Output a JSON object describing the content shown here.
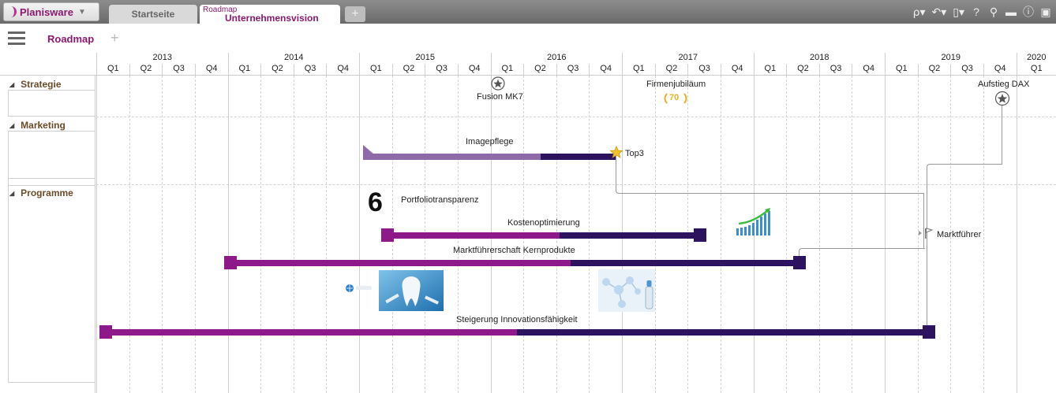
{
  "app": {
    "logo": "Planisware",
    "tabs": [
      {
        "label": "Startseite"
      },
      {
        "small": "Roadmap",
        "label": "Unternehmensvision"
      }
    ],
    "toolbar_icons": [
      "pin-icon",
      "undo-icon",
      "pdf-icon",
      "help-icon",
      "search-icon",
      "comment-icon",
      "info-icon",
      "save-icon"
    ]
  },
  "subheader": {
    "title": "Roadmap"
  },
  "timeline": {
    "years": [
      "2013",
      "2014",
      "2015",
      "2016",
      "2017",
      "2018",
      "2019",
      "2020"
    ],
    "quarters": [
      "Q1",
      "Q2",
      "Q3",
      "Q4"
    ]
  },
  "groups": [
    {
      "label": "Strategie"
    },
    {
      "label": "Marketing"
    },
    {
      "label": "Programme"
    }
  ],
  "milestones": {
    "fusion": "Fusion MK7",
    "jubilaeum": "Firmenjubiläum",
    "jubilaeum_badge": "70",
    "dax": "Aufstieg DAX",
    "top3": "Top3",
    "marktfuehrer": "Marktführer"
  },
  "bars": {
    "imagepflege": "Imagepflege",
    "portfolio_icon": "6",
    "portfolio": "Portfoliotransparenz",
    "kosten": "Kostenoptimierung",
    "markt": "Marktführerschaft Kernprodukte",
    "innovation": "Steigerung Innovationsfähigkeit"
  },
  "colors": {
    "brand": "#8a1a6f",
    "bar_magenta": "#8e1a8a",
    "bar_dark": "#2d1260",
    "bar_light": "#8f6aa8",
    "gold": "#e0b422"
  }
}
